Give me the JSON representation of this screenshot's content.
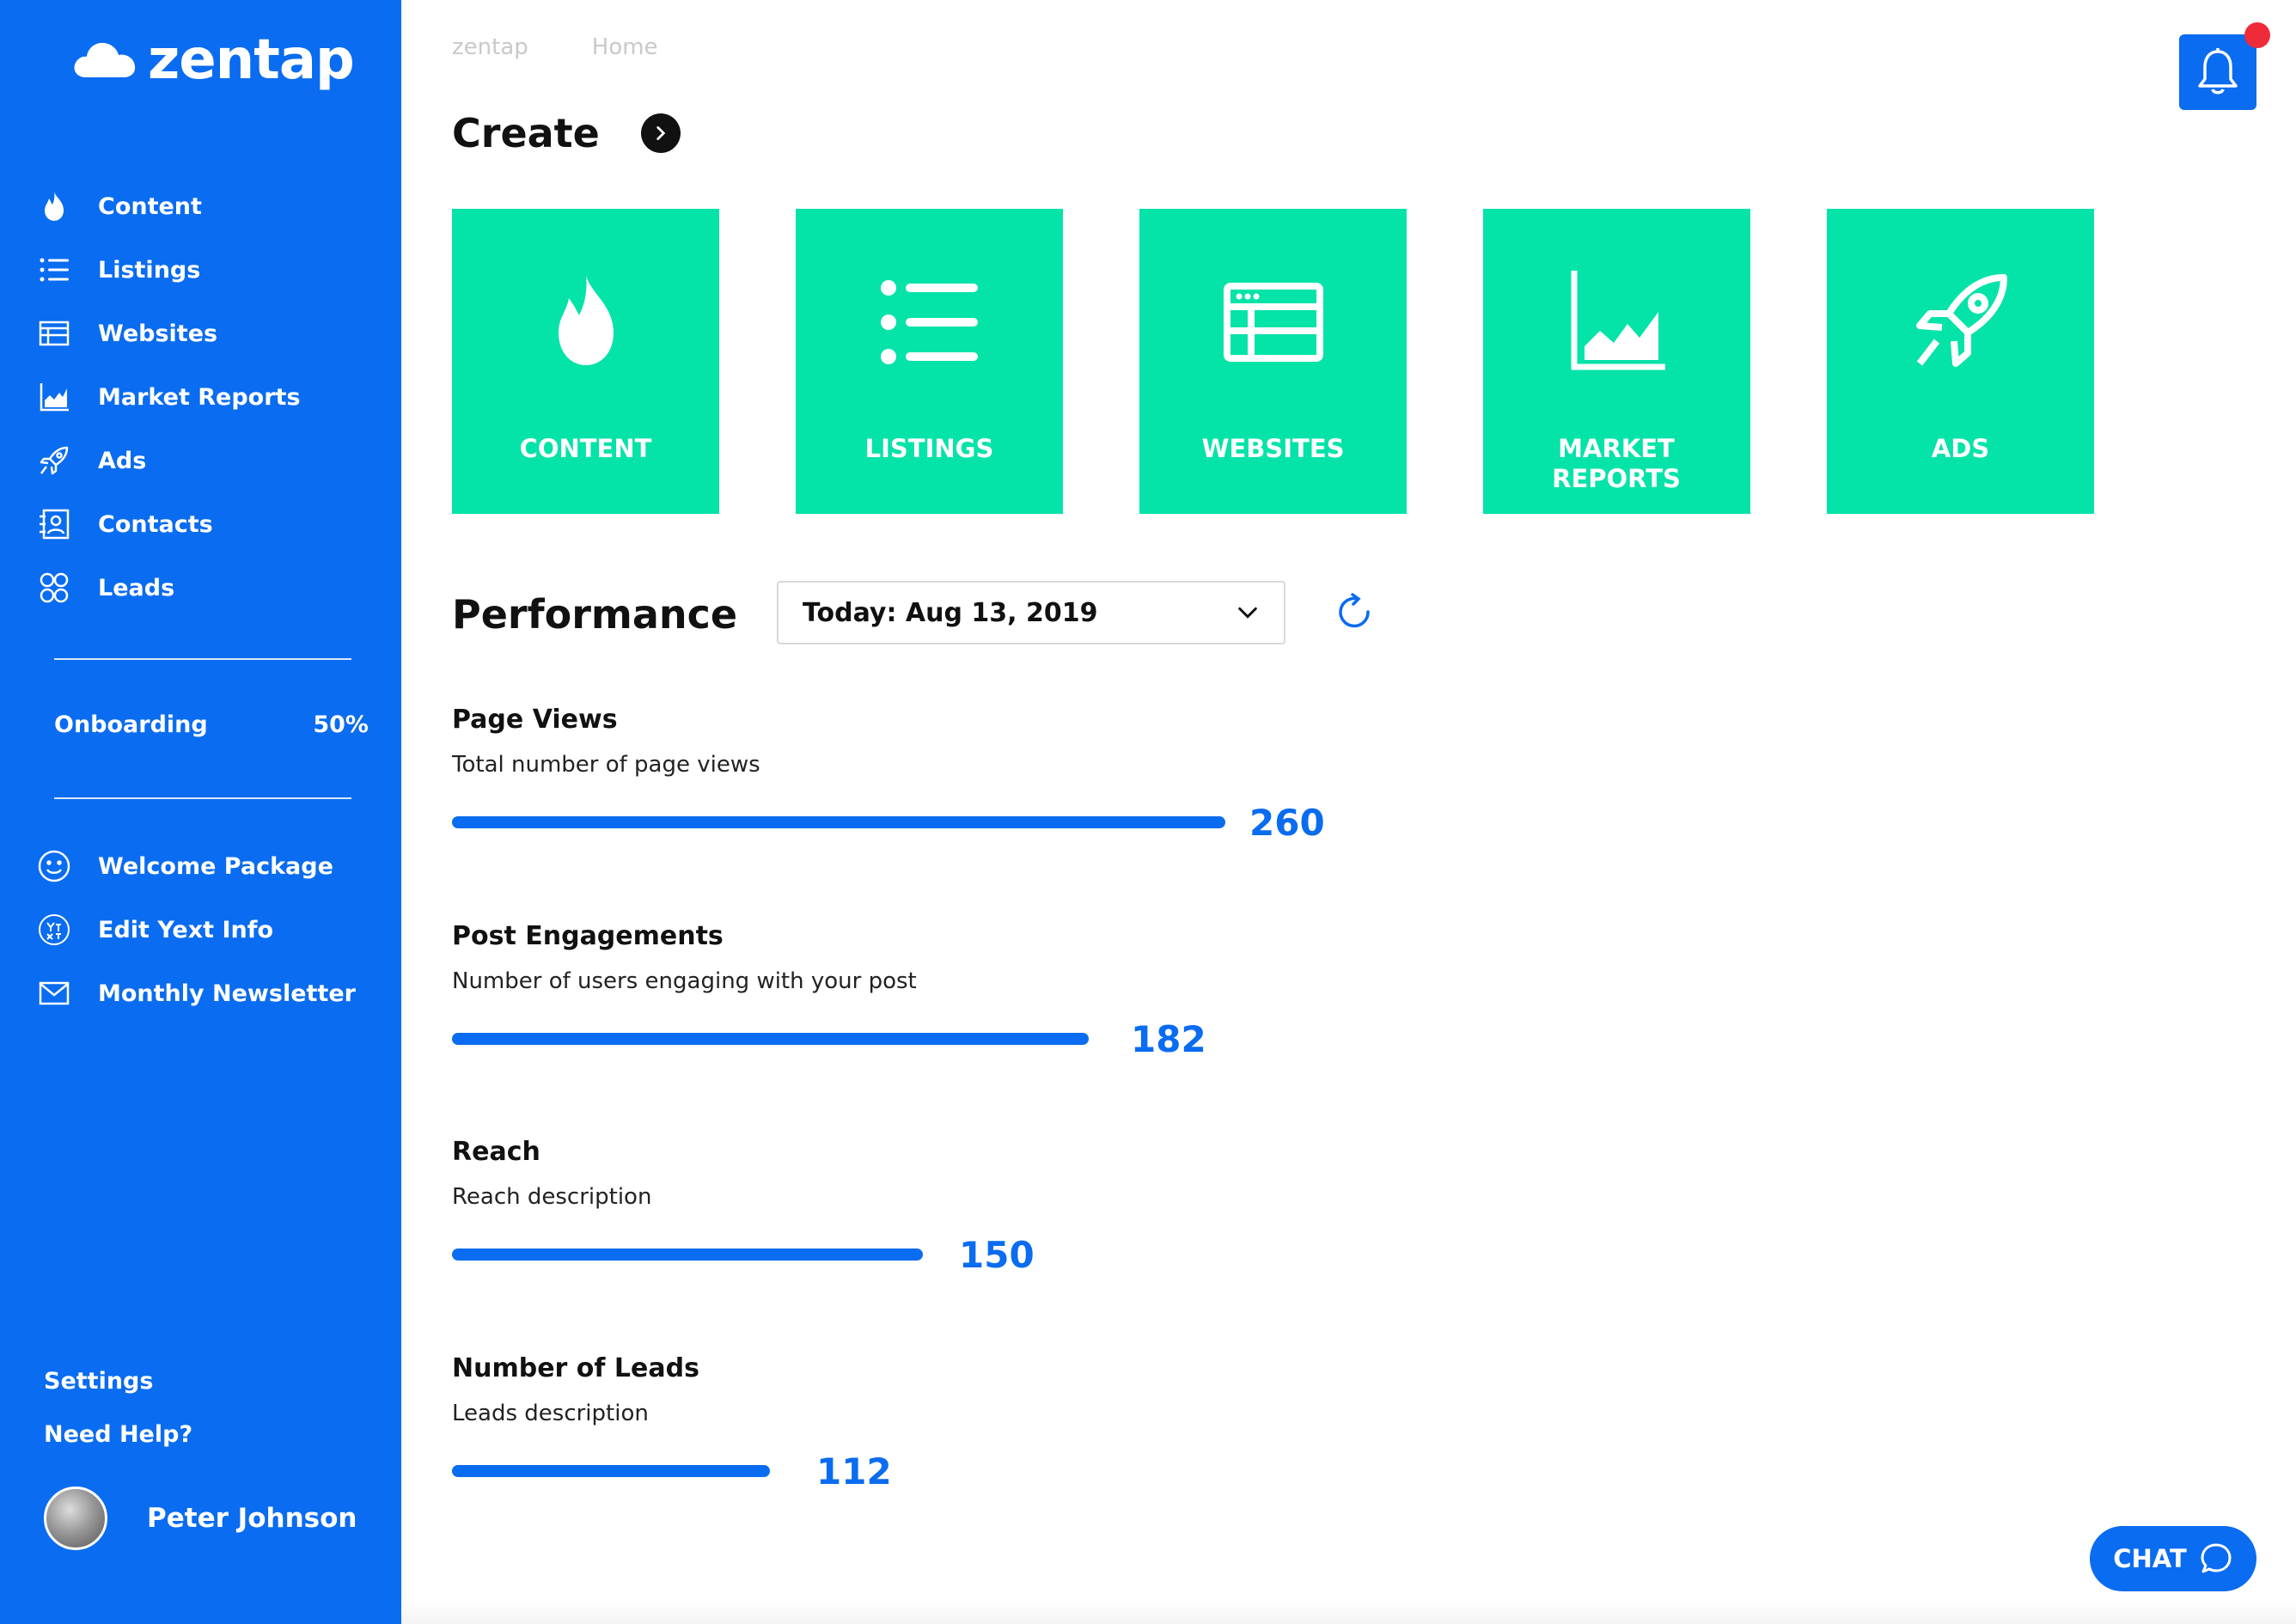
{
  "brand": {
    "name": "zentap"
  },
  "colors": {
    "primary_blue": "#0a6cf0",
    "tile_green": "#04e3a8",
    "notification_red": "#ef2b3a"
  },
  "sidebar": {
    "nav": [
      {
        "label": "Content",
        "icon": "flame-icon"
      },
      {
        "label": "Listings",
        "icon": "list-icon"
      },
      {
        "label": "Websites",
        "icon": "browser-icon"
      },
      {
        "label": "Market Reports",
        "icon": "area-chart-icon"
      },
      {
        "label": "Ads",
        "icon": "rocket-icon"
      },
      {
        "label": "Contacts",
        "icon": "contacts-icon"
      },
      {
        "label": "Leads",
        "icon": "leads-icon"
      }
    ],
    "onboarding": {
      "label": "Onboarding",
      "percent": "50%"
    },
    "extras": [
      {
        "label": "Welcome Package",
        "icon": "smiley-icon"
      },
      {
        "label": "Edit Yext Info",
        "icon": "yext-icon"
      },
      {
        "label": "Monthly Newsletter",
        "icon": "mail-icon"
      }
    ],
    "settings_label": "Settings",
    "help_label": "Need Help?",
    "user_name": "Peter Johnson"
  },
  "breadcrumb": {
    "items": [
      "zentap",
      "Home"
    ]
  },
  "create": {
    "title": "Create",
    "tiles": [
      {
        "label": "CONTENT",
        "icon": "flame-icon"
      },
      {
        "label": "LISTINGS",
        "icon": "list-icon"
      },
      {
        "label": "WEBSITES",
        "icon": "browser-icon"
      },
      {
        "label": "MARKET REPORTS",
        "icon": "area-chart-icon"
      },
      {
        "label": "ADS",
        "icon": "rocket-icon"
      }
    ]
  },
  "performance": {
    "title": "Performance",
    "date_selected": "Today: Aug 13, 2019",
    "metrics": [
      {
        "title": "Page Views",
        "description": "Total number of page views",
        "value": "260"
      },
      {
        "title": "Post Engagements",
        "description": "Number of users engaging with your post",
        "value": "182"
      },
      {
        "title": "Reach",
        "description": "Reach description",
        "value": "150"
      },
      {
        "title": "Number of Leads",
        "description": "Leads description",
        "value": "112"
      }
    ]
  },
  "chat": {
    "label": "CHAT"
  }
}
